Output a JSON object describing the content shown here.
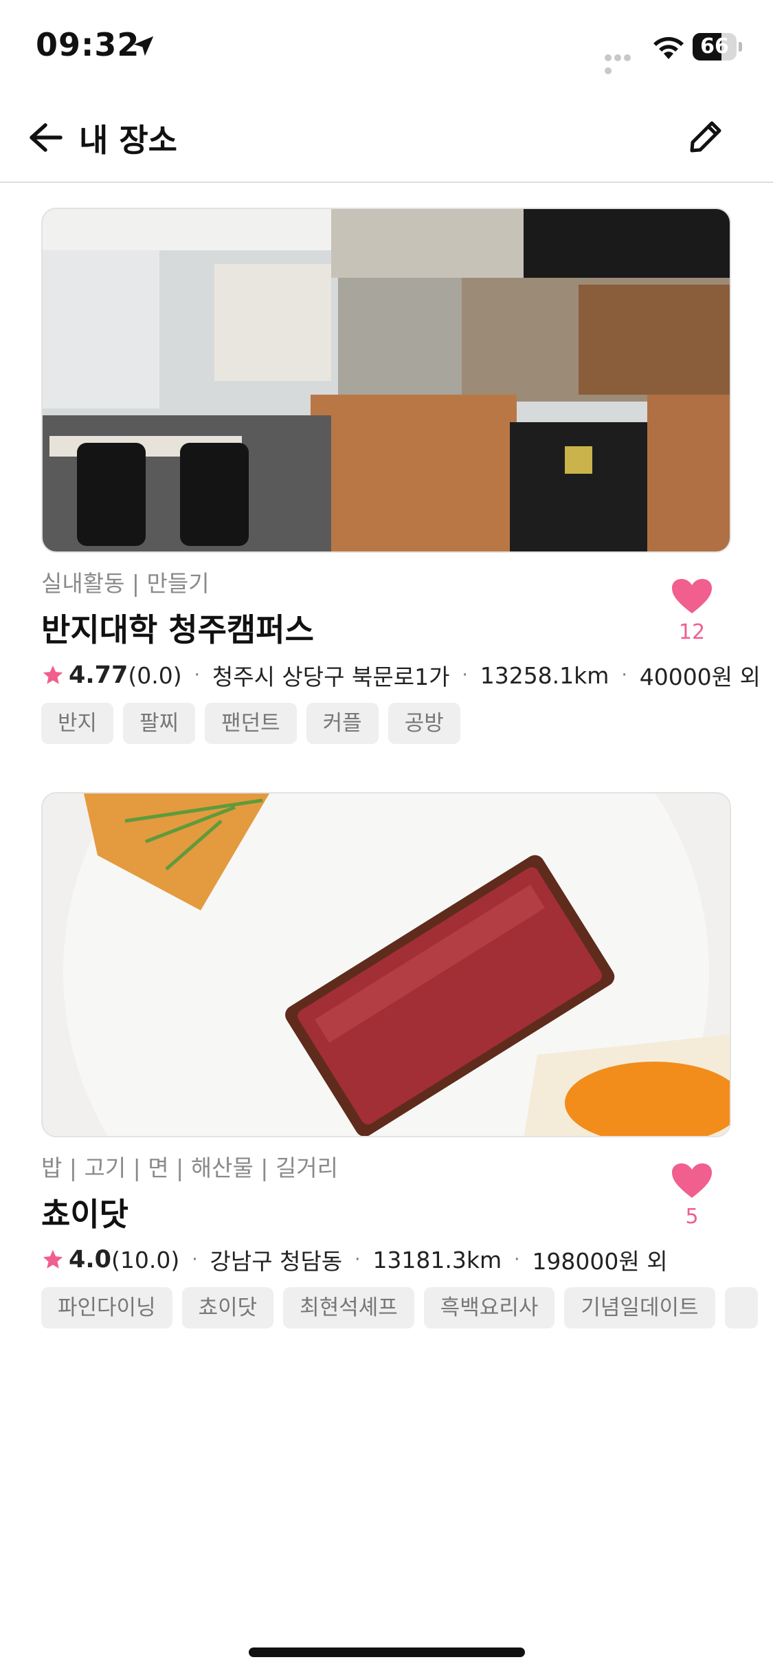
{
  "status_bar": {
    "time": "09:32",
    "battery_level": 0.66,
    "battery_text": "66",
    "icons": [
      "location-arrow-icon",
      "signal-icon",
      "wifi-icon",
      "battery-icon"
    ]
  },
  "header": {
    "back_icon": "arrow-left-icon",
    "title": "내 장소",
    "edit_icon": "pencil-icon"
  },
  "colors": {
    "accent_pink": "#f05f8e",
    "tag_bg": "#efefef",
    "tag_text": "#777777",
    "category_text": "#8a8a8a"
  },
  "places": [
    {
      "image_alt": "cafe interior photo",
      "category": "실내활동 | 만들기",
      "name": "반지대학 청주캠퍼스",
      "liked": true,
      "likes": "12",
      "rating": "4.77",
      "review": "(0.0)",
      "address": "청주시 상당구 북문로1가",
      "distance": "13258.1km",
      "price": "40000원 외",
      "tags": [
        "반지",
        "팔찌",
        "팬던트",
        "커플",
        "공방"
      ]
    },
    {
      "image_alt": "steak on plate photo",
      "category": "밥 | 고기 | 면 | 해산물 | 길거리",
      "name": "쵸이닷",
      "liked": true,
      "likes": "5",
      "rating": "4.0",
      "review": "(10.0)",
      "address": "강남구 청담동",
      "distance": "13181.3km",
      "price": "198000원 외",
      "tags": [
        "파인다이닝",
        "쵸이닷",
        "최현석셰프",
        "흑백요리사",
        "기념일데이트",
        ""
      ]
    }
  ]
}
